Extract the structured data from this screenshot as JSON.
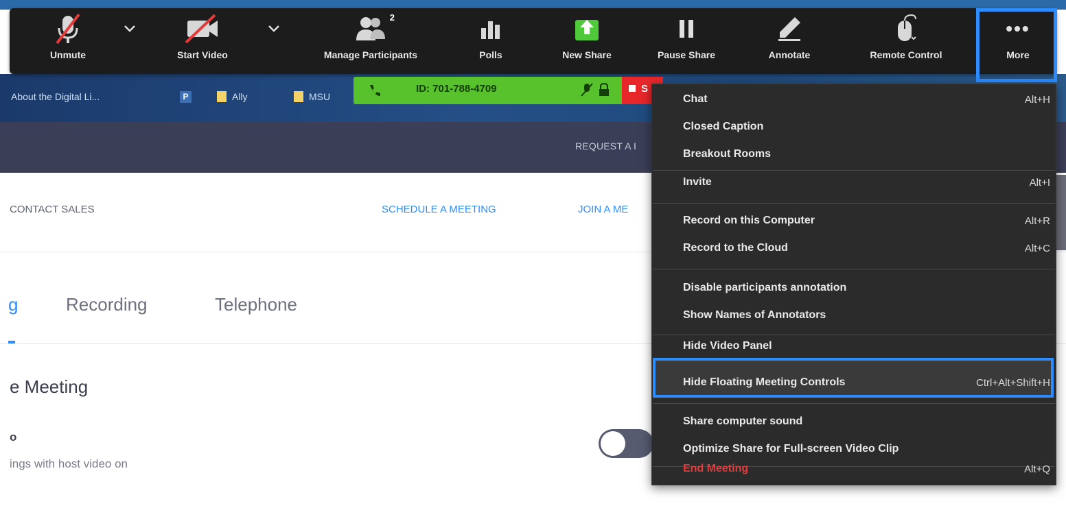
{
  "toolbar": {
    "unmute_label": "Unmute",
    "start_video_label": "Start Video",
    "manage_participants_label": "Manage Participants",
    "participant_count": "2",
    "polls_label": "Polls",
    "new_share_label": "New Share",
    "pause_share_label": "Pause Share",
    "annotate_label": "Annotate",
    "remote_control_label": "Remote Control",
    "more_label": "More",
    "more_icon": "•••"
  },
  "meeting_bar": {
    "id_text": "ID: 701-788-4709",
    "stop_share_label": "S"
  },
  "bookmarks": {
    "item1": "About the Digital Li...",
    "item2_icon": "P",
    "item3": "Ally",
    "item4": "MSU"
  },
  "page": {
    "request_link": "REQUEST A I",
    "contact_sales": "CONTACT SALES",
    "schedule_meeting": "SCHEDULE A MEETING",
    "join_meeting": "JOIN A ME",
    "tab_meeting_fragment": "g",
    "tab_recording": "Recording",
    "tab_telephone": "Telephone",
    "section_title": "e Meeting",
    "setting_label": "o",
    "setting_desc": "ings with host video on"
  },
  "menu": {
    "items": [
      {
        "label": "Chat",
        "shortcut": "Alt+H"
      },
      {
        "label": "Closed Caption",
        "shortcut": ""
      },
      {
        "label": "Breakout Rooms",
        "shortcut": ""
      },
      {
        "label": "Invite",
        "shortcut": "Alt+I"
      },
      {
        "label": "Record on this Computer",
        "shortcut": "Alt+R"
      },
      {
        "label": "Record to the Cloud",
        "shortcut": "Alt+C"
      },
      {
        "label": "Disable participants annotation",
        "shortcut": ""
      },
      {
        "label": "Show Names of Annotators",
        "shortcut": ""
      },
      {
        "label": "Hide Video Panel",
        "shortcut": ""
      },
      {
        "label": "Hide Floating Meeting Controls",
        "shortcut": "Ctrl+Alt+Shift+H"
      },
      {
        "label": "Share computer sound",
        "shortcut": ""
      },
      {
        "label": "Optimize Share for Full-screen Video Clip",
        "shortcut": ""
      },
      {
        "label": "End Meeting",
        "shortcut": "Alt+Q"
      }
    ]
  },
  "colors": {
    "highlight": "#2d8cff",
    "toolbar_bg": "#1c1c1c",
    "menu_bg": "#2b2b2b",
    "id_bar": "#57c22b",
    "end_meeting": "#e23b3b",
    "new_share_icon": "#4fc83a"
  }
}
